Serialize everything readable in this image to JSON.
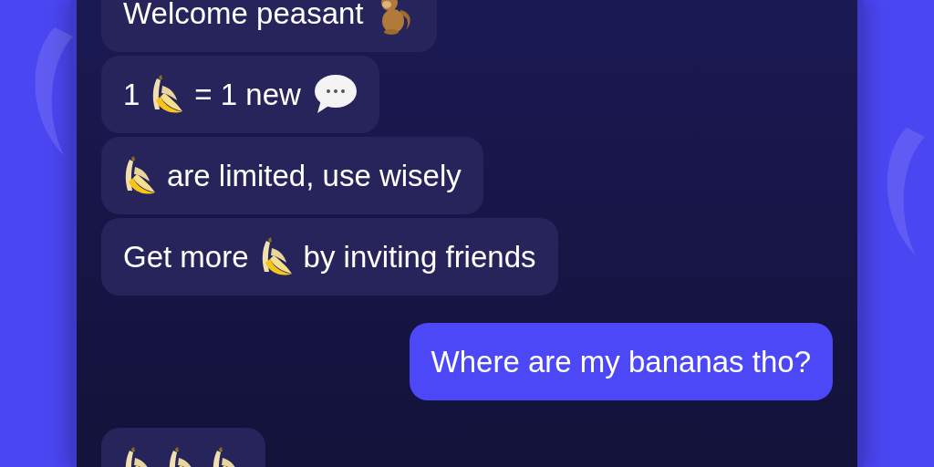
{
  "messages": [
    {
      "outgoing": false,
      "parts": [
        {
          "kind": "text",
          "text": "Welcome peasant"
        },
        {
          "kind": "monkey"
        }
      ]
    },
    {
      "outgoing": false,
      "parts": [
        {
          "kind": "text",
          "text": "1"
        },
        {
          "kind": "banana"
        },
        {
          "kind": "text",
          "text": "= 1 new"
        },
        {
          "kind": "speech"
        }
      ]
    },
    {
      "outgoing": false,
      "parts": [
        {
          "kind": "banana"
        },
        {
          "kind": "text",
          "text": "are limited, use wisely"
        }
      ]
    },
    {
      "outgoing": false,
      "parts": [
        {
          "kind": "text",
          "text": "Get more"
        },
        {
          "kind": "banana"
        },
        {
          "kind": "text",
          "text": "by inviting friends"
        }
      ]
    },
    {
      "outgoing": true,
      "parts": [
        {
          "kind": "text",
          "text": "Where are my bananas tho?"
        }
      ]
    },
    {
      "outgoing": false,
      "parts": [
        {
          "kind": "banana"
        },
        {
          "kind": "banana"
        },
        {
          "kind": "banana"
        }
      ]
    }
  ]
}
